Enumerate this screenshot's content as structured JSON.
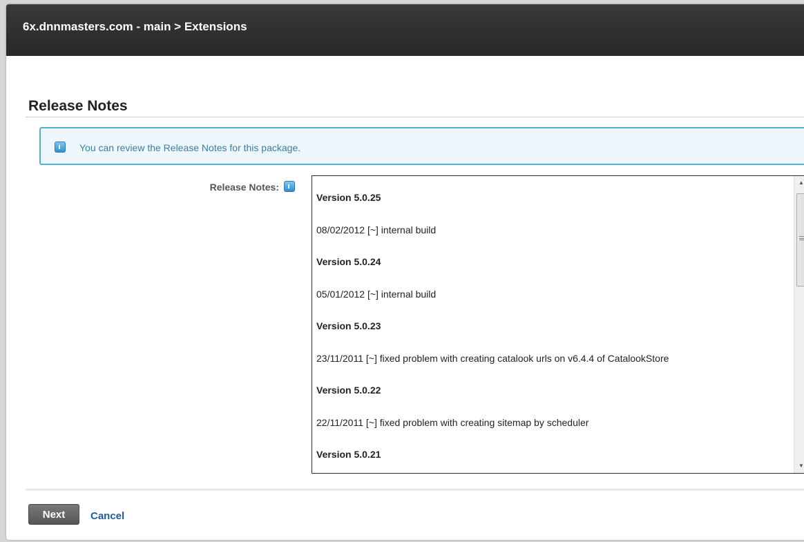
{
  "window": {
    "title": "6x.dnnmasters.com - main > Extensions"
  },
  "section": {
    "title": "Release Notes"
  },
  "info": {
    "icon": "info-icon",
    "text": "You can review the Release Notes for this package."
  },
  "field": {
    "label": "Release Notes:",
    "help_icon": "help-icon"
  },
  "release_notes": [
    {
      "text": "Version 5.0.25",
      "type": "version"
    },
    {
      "text": "08/02/2012 [~] internal build",
      "type": "note"
    },
    {
      "text": "Version 5.0.24",
      "type": "version"
    },
    {
      "text": "05/01/2012 [~] internal build",
      "type": "note"
    },
    {
      "text": "Version 5.0.23",
      "type": "version"
    },
    {
      "text": "23/11/2011 [~] fixed problem with creating catalook urls on v6.4.4 of CatalookStore",
      "type": "note"
    },
    {
      "text": "Version 5.0.22",
      "type": "version"
    },
    {
      "text": "22/11/2011 [~] fixed problem with creating sitemap by scheduler",
      "type": "note"
    },
    {
      "text": "Version 5.0.21",
      "type": "version"
    }
  ],
  "scrollbar": {
    "up_icon": "arrow-up-icon",
    "down_icon": "arrow-down-icon"
  },
  "actions": {
    "next_label": "Next",
    "cancel_label": "Cancel"
  },
  "colors": {
    "titlebar": "#2b2b2b",
    "info_border": "#4fb2d6",
    "info_text": "#3b7ea1",
    "link": "#1f5fa0"
  }
}
